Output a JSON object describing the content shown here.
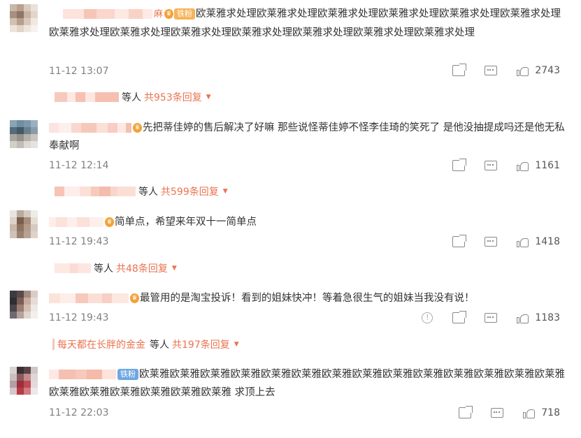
{
  "comments": [
    {
      "name_suffix": "麻",
      "badge": "铁粉",
      "text": "欧莱雅求处理欧莱雅求处理欧莱雅求处理欧莱雅求处理欧莱雅求处理欧莱雅求处理欧莱雅求处理欧莱雅求处理欧莱雅求处理欧莱雅求处理欧莱雅求处理欧莱雅求处理欧莱雅求处理",
      "time": "11-12 13:07",
      "likes": "2743",
      "reply_prefix": "等人",
      "reply_count": "共953条回复"
    },
    {
      "text": "先把蒂佳婷的售后解决了好嘛 那些说怪蒂佳婷不怪李佳琦的笑死了 是他没抽提成吗还是他无私奉献啊",
      "time": "11-12 12:14",
      "likes": "1161",
      "reply_prefix": "等人",
      "reply_count": "共599条回复"
    },
    {
      "text": "简单点，希望来年双十一简单点",
      "time": "11-12 19:43",
      "likes": "1418",
      "reply_prefix": "等人",
      "reply_count": "共48条回复"
    },
    {
      "text": "最管用的是淘宝投诉！看到的姐妹快冲！等着急很生气的姐妹当我没有说！",
      "time": "11-12 19:43",
      "likes": "1183",
      "replier": "每天都在长胖的金金",
      "reply_prefix": "等人",
      "reply_count": "共197条回复"
    },
    {
      "badge": "铁粉",
      "text": "欧莱雅欧莱雅欧莱雅欧莱雅欧莱雅欧莱雅欧莱雅欧莱雅欧莱雅欧莱雅欧莱雅欧莱雅欧莱雅欧莱雅欧莱雅欧莱雅欧莱雅欧莱雅欧莱雅欧莱雅 求顶上去",
      "time": "11-12 22:03",
      "likes": "718"
    }
  ],
  "icons": {
    "share": "share-icon",
    "comment": "comment-icon",
    "like": "like-icon",
    "report": "report-icon",
    "vip": "crown-icon",
    "dropdown": "chevron-down-icon"
  },
  "colors": {
    "accent": "#eb7350",
    "text": "#333333",
    "muted": "#808080"
  }
}
